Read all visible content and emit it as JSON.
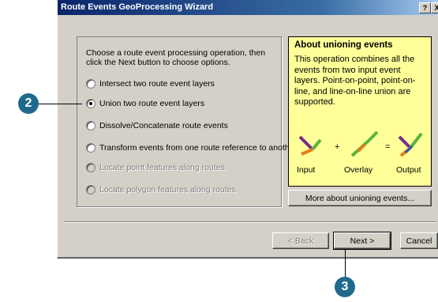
{
  "window": {
    "title": "Route Events GeoProcessing Wizard",
    "help_glyph": "?",
    "close_glyph": "X"
  },
  "options": {
    "instruction": "Choose a route event processing operation, then click the Next button to choose options.",
    "radios": [
      {
        "label": "Intersect two route event layers",
        "checked": false,
        "enabled": true
      },
      {
        "label": "Union two route event layers",
        "checked": true,
        "enabled": true
      },
      {
        "label": "Dissolve/Concatenate route events",
        "checked": false,
        "enabled": true
      },
      {
        "label": "Transform events from one route reference to another",
        "checked": false,
        "enabled": true
      },
      {
        "label": "Locate point features along routes",
        "checked": false,
        "enabled": false
      },
      {
        "label": "Locate polygon features along routes",
        "checked": false,
        "enabled": false
      }
    ]
  },
  "info": {
    "title": "About unioning events",
    "text": "This operation combines all the events from two input event layers. Point-on-point, point-on-line, and line-on-line union are supported.",
    "plus": "+",
    "equals": "=",
    "labels": {
      "input": "Input",
      "overlay": "Overlay",
      "output": "Output"
    },
    "colors": {
      "purple": "#7a2a8a",
      "green": "#56b43c",
      "orange": "#e87a1e",
      "blue": "#2a56b4",
      "accent": "#ffff99"
    }
  },
  "buttons": {
    "more": "More about unioning events...",
    "back": "< Back",
    "next": "Next >",
    "cancel": "Cancel"
  },
  "callouts": {
    "step2": "2",
    "step3": "3"
  }
}
